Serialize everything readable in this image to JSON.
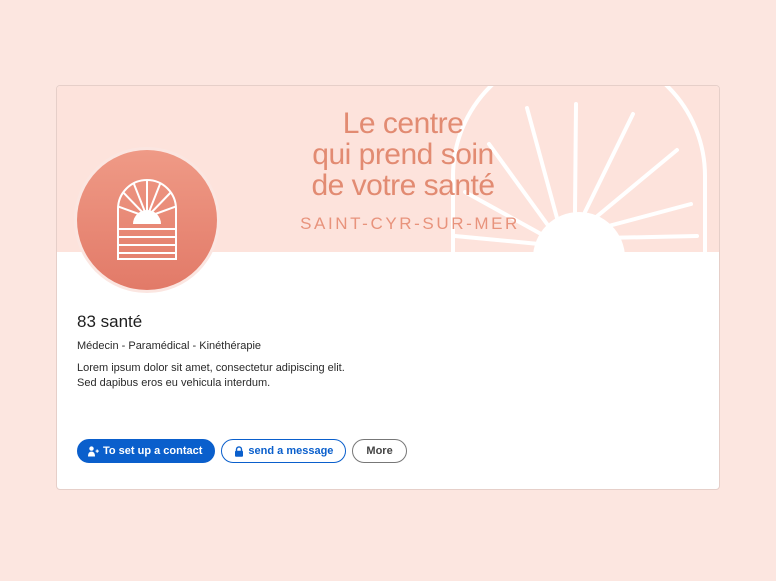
{
  "banner": {
    "tagline": [
      "Le centre",
      "qui prend soin",
      "de votre santé"
    ],
    "city": "SAINT-CYR-SUR-MER"
  },
  "profile": {
    "name": "83 santé",
    "categories": "Médecin - Paramédical - Kinéthérapie",
    "description": [
      "Lorem ipsum dolor sit amet, consectetur adipiscing elit.",
      "Sed dapibus eros eu vehicula interdum."
    ]
  },
  "actions": {
    "contact_label": "To set up a contact",
    "message_label": "send a message",
    "more_label": "More"
  },
  "colors": {
    "page_background": "#fce6e0",
    "banner_background": "#fde3dc",
    "accent_salmon": "#e28b72",
    "primary_blue": "#0a5fcc"
  },
  "icons": {
    "logo": "sunrise-logo-icon",
    "contact": "add-user-icon",
    "message": "lock-icon",
    "banner": "sunrise-arch-icon"
  }
}
